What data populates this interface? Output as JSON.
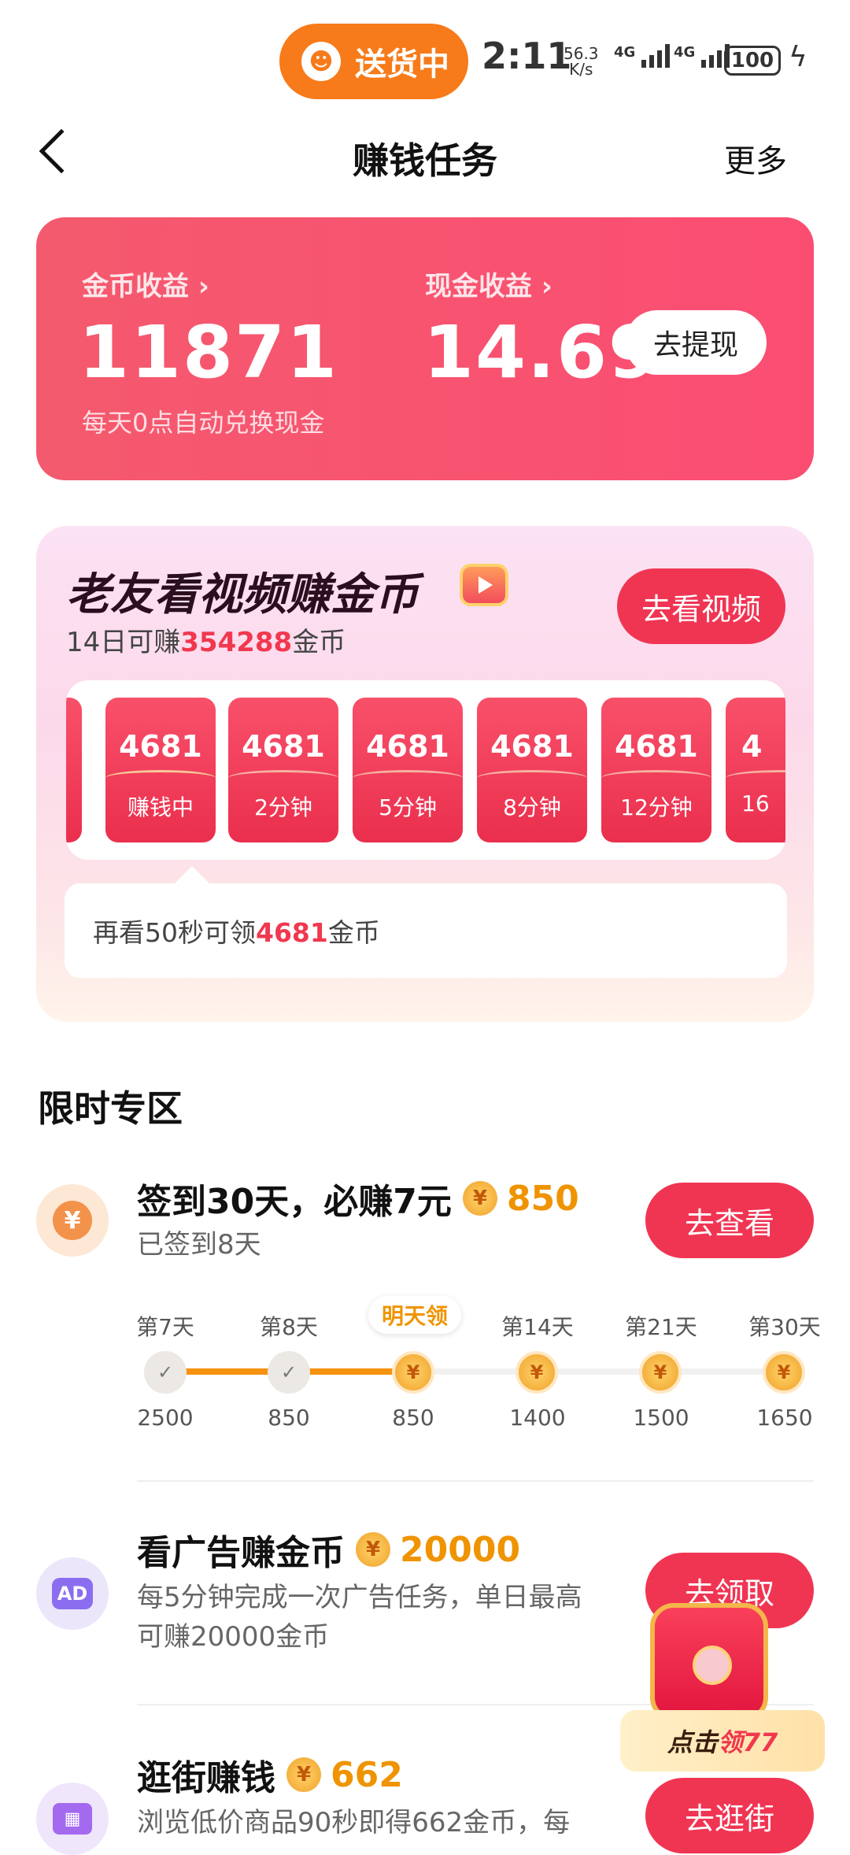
{
  "status_bar": {
    "delivery_label": "送货中",
    "time": "2:11",
    "net_speed_value": "56.3",
    "net_speed_unit": "K/s",
    "network_1": "4G",
    "network_2": "4G",
    "battery": "100"
  },
  "header": {
    "title": "赚钱任务",
    "more": "更多"
  },
  "earnings": {
    "coin_label": "金币收益 ›",
    "coin_value": "11871",
    "cash_label": "现金收益 ›",
    "cash_value": "14.69",
    "withdraw_button": "去提现",
    "note": "每天0点自动兑换现金"
  },
  "video_task": {
    "title": "老友看视频赚金币",
    "subtitle_prefix": "14日可赚",
    "subtitle_amount": "354288",
    "subtitle_suffix": "金币",
    "button": "去看视频",
    "tiles": [
      {
        "amount": "4681",
        "label": "赚钱中"
      },
      {
        "amount": "4681",
        "label": "2分钟"
      },
      {
        "amount": "4681",
        "label": "5分钟"
      },
      {
        "amount": "4681",
        "label": "8分钟"
      },
      {
        "amount": "4681",
        "label": "12分钟"
      },
      {
        "amount": "4",
        "label": "16"
      }
    ],
    "tip_prefix": "再看50秒可领",
    "tip_amount": "4681",
    "tip_suffix": "金币"
  },
  "limited": {
    "section_title": "限时专区",
    "checkin": {
      "icon": "¥",
      "title": "签到30天，必赚7元",
      "reward": "850",
      "subtitle": "已签到8天",
      "button": "去查看",
      "tomorrow_label": "明天领",
      "days": [
        "第7天",
        "第8天",
        "",
        "第14天",
        "第21天",
        "第30天"
      ],
      "amounts": [
        "2500",
        "850",
        "850",
        "1400",
        "1500",
        "1650"
      ],
      "progress_fraction": 0.4
    },
    "ad": {
      "icon": "AD",
      "title": "看广告赚金币",
      "reward": "20000",
      "subtitle_line1": "每5分钟完成一次广告任务，单日最高",
      "subtitle_line2": "可赚20000金币",
      "button": "去领取"
    },
    "shop": {
      "title": "逛街赚钱",
      "reward": "662",
      "subtitle": "浏览低价商品90秒即得662金币，每",
      "button": "去逛街"
    }
  },
  "floating": {
    "label_prefix": "点击",
    "label_reward": "领77"
  },
  "colors": {
    "accent_red": "#f03553",
    "coin_orange": "#ef9400",
    "delivery_orange": "#f77b1a"
  }
}
